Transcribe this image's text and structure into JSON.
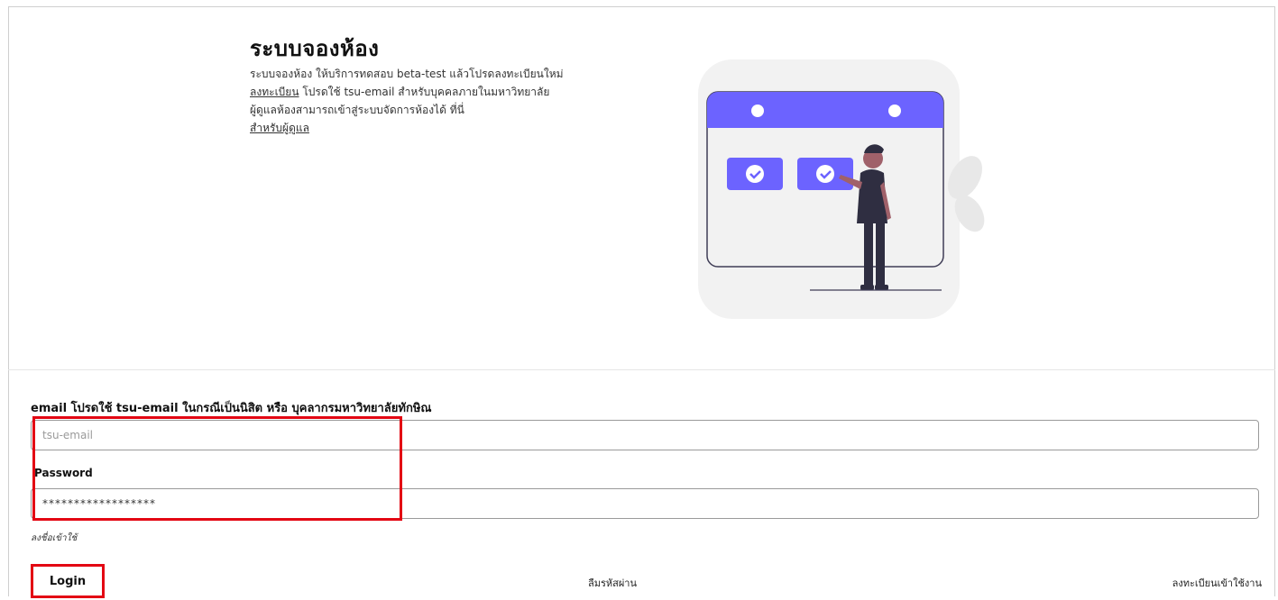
{
  "hero": {
    "title": "ระบบจองห้อง",
    "line1": "ระบบจองห้อง ให้บริการทดสอบ beta-test แล้วโปรดลงทะเบียนใหม่",
    "register_link": "ลงทะเบียน",
    "line2_rest": " โปรดใช้ tsu-email สำหรับบุคคลภายในมหาวิทยาลัย",
    "line3": "ผู้ดูแลห้องสามารถเข้าสู่ระบบจัดการห้องได้ ที่นี่",
    "admin_link": "สำหรับผู้ดูแล"
  },
  "form": {
    "email_label": "email โปรดใช้ tsu-email ในกรณีเป็นนิสิต หรือ บุคลากรมหาวิทยาลัยทักษิณ",
    "email_placeholder": "tsu-email",
    "password_label": "Password",
    "password_value": "******************",
    "hint": "ลงชื่อเข้าใช้",
    "login_label": "Login",
    "forgot_label": "ลืมรหัสผ่าน",
    "register_label": "ลงทะเบียนเข้าใช้งาน"
  },
  "colors": {
    "accent": "#6c63ff",
    "highlight": "#e30613",
    "figure_dark": "#2f2e41",
    "skin": "#a0616a"
  },
  "icons": [
    "calendar-illustration",
    "check-circle-icon",
    "person-figure",
    "leaf-decoration"
  ]
}
